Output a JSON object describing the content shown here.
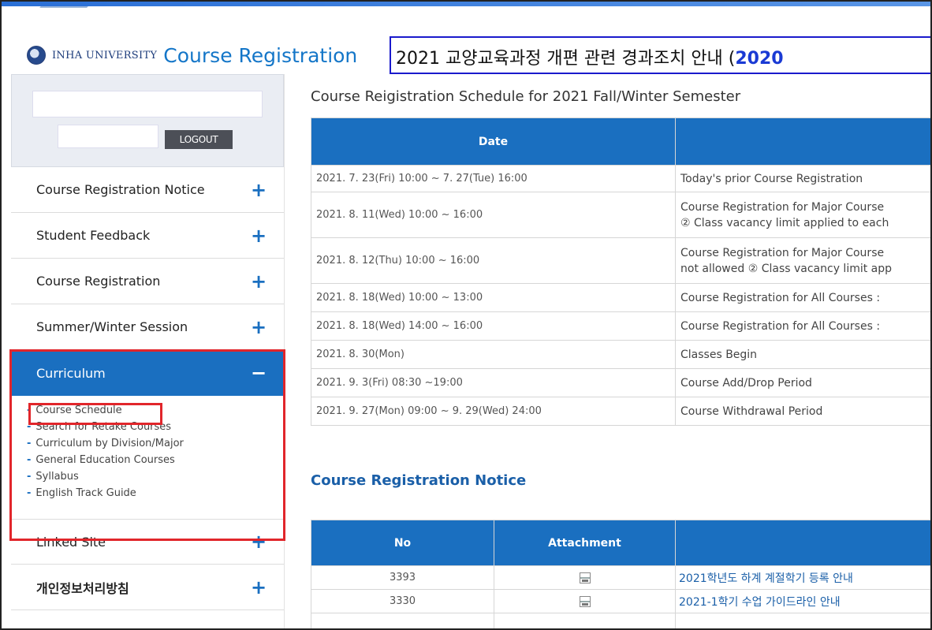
{
  "header": {
    "university": "INHA UNIVERSITY",
    "title": "Course Registration",
    "notice_text": "2021 교양교육과정 개편 관련 경과조치 안내 (",
    "notice_highlight": "2020"
  },
  "sidebar": {
    "logout_label": "LOGOUT",
    "items": [
      {
        "label": "Course Registration Notice",
        "icon": "plus"
      },
      {
        "label": "Student Feedback",
        "icon": "plus"
      },
      {
        "label": "Course Registration",
        "icon": "plus"
      },
      {
        "label": "Summer/Winter Session",
        "icon": "plus"
      },
      {
        "label": "Curriculum",
        "icon": "minus"
      },
      {
        "label": "Linked Site",
        "icon": "plus"
      },
      {
        "label": "개인정보처리방침",
        "icon": "plus"
      }
    ],
    "submenu": [
      "Course Schedule",
      "Search for Retake Courses",
      "Curriculum by Division/Major",
      "General Education Courses",
      "Syllabus",
      "English Track Guide"
    ]
  },
  "schedule": {
    "title": "Course Reigistration Schedule for 2021 Fall/Winter Semester",
    "col_date": "Date",
    "rows": [
      {
        "date": "2021. 7. 23(Fri) 10:00 ~ 7. 27(Tue) 16:00",
        "desc1": "Today's prior Course Registration",
        "desc2": ""
      },
      {
        "date": "2021. 8. 11(Wed) 10:00 ~ 16:00",
        "desc1": "Course Registration for Major Course",
        "desc2": "② Class vacancy limit applied to each"
      },
      {
        "date": "2021. 8. 12(Thu) 10:00 ~ 16:00",
        "desc1": "Course Registration for Major Course",
        "desc2": "not allowed ② Class vacancy limit app"
      },
      {
        "date": "2021. 8. 18(Wed) 10:00 ~ 13:00",
        "desc1": "Course Registration for All Courses : ",
        "desc2": ""
      },
      {
        "date": "2021. 8. 18(Wed) 14:00 ~ 16:00",
        "desc1": "Course Registration for All Courses : ",
        "desc2": ""
      },
      {
        "date": "2021. 8. 30(Mon)",
        "desc1": "Classes Begin",
        "desc2": ""
      },
      {
        "date": "2021. 9. 3(Fri) 08:30 ~19:00",
        "desc1": "Course Add/Drop Period",
        "desc2": ""
      },
      {
        "date": "2021. 9. 27(Mon) 09:00 ~ 9. 29(Wed) 24:00",
        "desc1": "Course Withdrawal Period",
        "desc2": ""
      }
    ]
  },
  "notices": {
    "title": "Course Registration Notice",
    "col_no": "No",
    "col_attachment": "Attachment",
    "rows": [
      {
        "no": "3393",
        "title": "2021학년도 하계 계절학기 등록 안내"
      },
      {
        "no": "3330",
        "title": "2021-1학기 수업 가이드라인 안내"
      }
    ]
  },
  "colors": {
    "accent": "#1a6fc0",
    "highlight_outline": "#e1262b",
    "notice_border": "#1a1acc"
  }
}
